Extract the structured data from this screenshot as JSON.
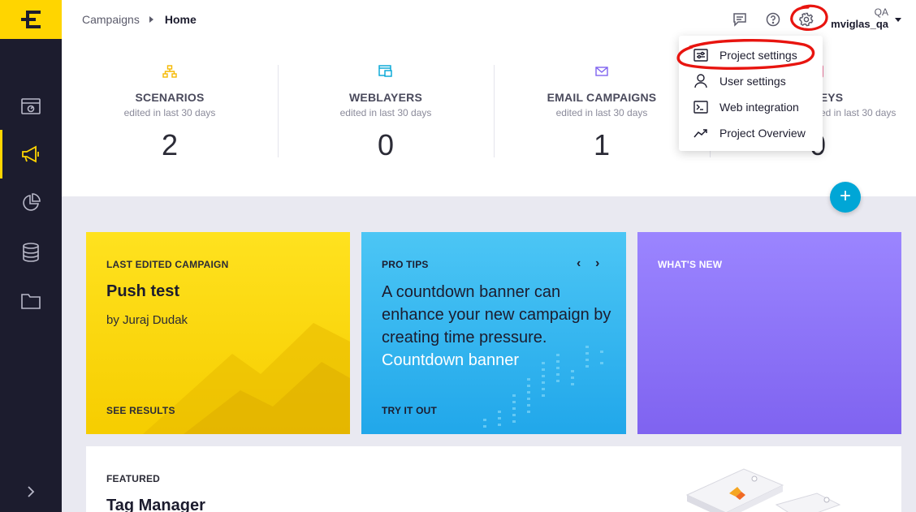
{
  "sidebar": {
    "items": [
      {
        "icon": "calendar-dashboard-icon"
      },
      {
        "icon": "megaphone-icon",
        "active": true
      },
      {
        "icon": "pie-chart-icon"
      },
      {
        "icon": "database-icon"
      },
      {
        "icon": "folder-icon"
      }
    ],
    "expand_icon": "chevron-right-icon"
  },
  "header": {
    "breadcrumb": [
      "Campaigns",
      "Home"
    ],
    "user_role": "QA",
    "user_name": "mviglas_qa"
  },
  "stats": [
    {
      "title": "SCENARIOS",
      "subtitle": "edited in last 30 days",
      "value": "2",
      "color": "#f5b800"
    },
    {
      "title": "WEBLAYERS",
      "subtitle": "edited in last 30 days",
      "value": "0",
      "color": "#00a6d6"
    },
    {
      "title": "EMAIL CAMPAIGNS",
      "subtitle": "edited in last 30 days",
      "value": "1",
      "color": "#7f63f0"
    },
    {
      "title": "EYS",
      "subtitle": "edited in last 30 days",
      "value": "0",
      "color": "#e8457a"
    }
  ],
  "cards": {
    "last_edited": {
      "label": "LAST EDITED CAMPAIGN",
      "title": "Push test",
      "author": "by Juraj Dudak",
      "footer": "SEE RESULTS"
    },
    "pro_tips": {
      "label": "PRO TIPS",
      "text": "A countdown banner can enhance your new campaign by creating time pressure.",
      "link": "Countdown banner",
      "footer": "TRY IT OUT",
      "prev": "‹",
      "next": "›"
    },
    "whats_new": {
      "label": "WHAT'S NEW"
    }
  },
  "featured": {
    "label": "FEATURED",
    "title": "Tag Manager"
  },
  "settings_menu": {
    "items": [
      {
        "label": "Project settings",
        "icon": "sliders-icon"
      },
      {
        "label": "User settings",
        "icon": "user-icon"
      },
      {
        "label": "Web integration",
        "icon": "terminal-icon"
      },
      {
        "label": "Project Overview",
        "icon": "trend-up-icon"
      }
    ]
  },
  "colors": {
    "brand_yellow": "#ffd500",
    "sidebar_bg": "#1c1c2e",
    "accent_blue": "#00a6d6",
    "annotation_red": "#e8140f"
  }
}
